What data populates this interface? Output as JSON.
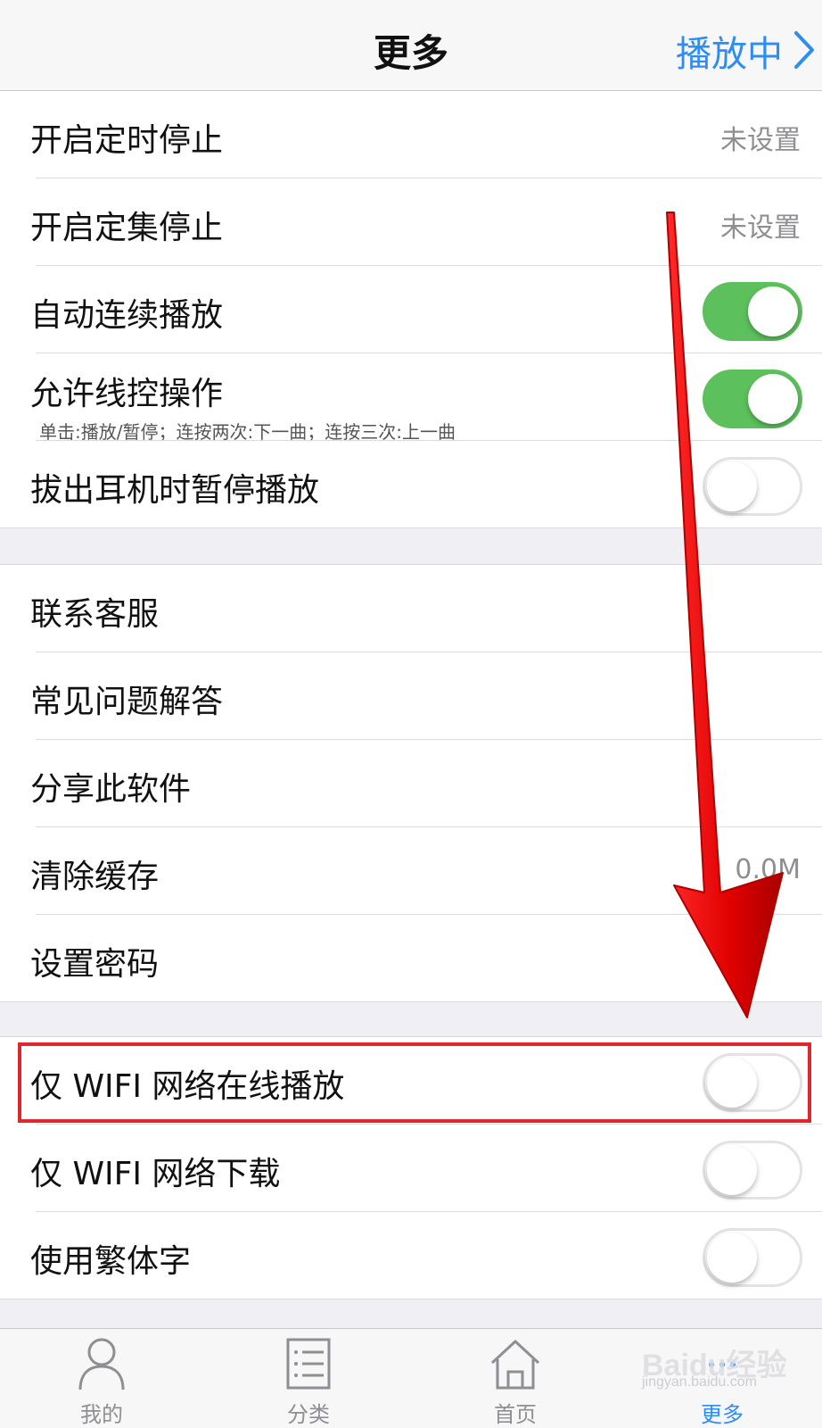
{
  "navbar": {
    "title": "更多",
    "right_label": "播放中"
  },
  "section1": {
    "timer_stop": {
      "label": "开启定时停止",
      "value": "未设置"
    },
    "episode_stop": {
      "label": "开启定集停止",
      "value": "未设置"
    },
    "auto_play": {
      "label": "自动连续播放",
      "on": true
    },
    "wire_control": {
      "label": "允许线控操作",
      "sub": "单击:播放/暂停；连按两次:下一曲；连按三次:上一曲",
      "on": true
    },
    "headphone_pause": {
      "label": "拔出耳机时暂停播放",
      "on": false
    }
  },
  "section2": {
    "contact": {
      "label": "联系客服"
    },
    "faq": {
      "label": "常见问题解答"
    },
    "share": {
      "label": "分享此软件"
    },
    "clear_cache": {
      "label": "清除缓存",
      "value": "0.0M"
    },
    "password": {
      "label": "设置密码"
    }
  },
  "section3": {
    "wifi_play": {
      "label": "仅 WIFI 网络在线播放",
      "on": false
    },
    "wifi_download": {
      "label": "仅 WIFI 网络下载",
      "on": false
    },
    "traditional": {
      "label": "使用繁体字",
      "on": false
    }
  },
  "tabbar": {
    "tabs": [
      {
        "label": "我的",
        "icon": "person-icon"
      },
      {
        "label": "分类",
        "icon": "list-icon"
      },
      {
        "label": "首页",
        "icon": "home-icon"
      },
      {
        "label": "更多",
        "icon": "more-icon",
        "active": true
      }
    ]
  },
  "watermark": {
    "text": "Baidu经验",
    "sub": "jingyan.baidu.com"
  },
  "colors": {
    "accent": "#2f8cf0",
    "toggle_on": "#5cc05c",
    "annotation_red": "#e0262f"
  }
}
